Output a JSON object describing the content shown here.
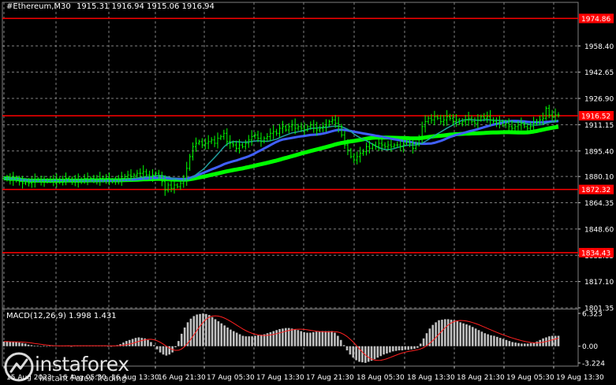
{
  "header": {
    "symbol": "#Ethereum,M30",
    "ohlc": "1915.31 1916.94 1915.06 1916.94"
  },
  "macd": {
    "label": "MACD(12,26,9) 1.998 1.431",
    "axis_labels": [
      "6.323",
      "0.00",
      "-3.224"
    ]
  },
  "branding": {
    "name": "instaforex",
    "tagline": "Instant Forex Trading"
  },
  "colors": {
    "background": "#000000",
    "candle": "#00ff00",
    "grid": "#808080",
    "level_line": "#ff0000",
    "ma_fast": "#20a0a0",
    "ma_medium": "#4060ff",
    "ma_slow": "#00ff00",
    "macd_hist": "#c0c0c0",
    "macd_signal": "#ff2020"
  },
  "chart_data": {
    "type": "candlestick",
    "symbol": "#Ethereum",
    "timeframe": "M30",
    "ylim": [
      1801.35,
      1984.5
    ],
    "price_ticks": [
      "1958.40",
      "1942.65",
      "1926.90",
      "1911.15",
      "1895.40",
      "1880.10",
      "1864.35",
      "1848.60",
      "1832.85",
      "1817.10",
      "1801.35"
    ],
    "x_ticks": [
      "15 Aug 2023",
      "16 Aug 05:30",
      "16 Aug 13:30",
      "16 Aug 21:30",
      "17 Aug 05:30",
      "17 Aug 13:30",
      "17 Aug 21:30",
      "18 Aug 05:30",
      "18 Aug 13:30",
      "18 Aug 21:30",
      "19 Aug 05:30",
      "19 Aug 13:30"
    ],
    "levels": [
      {
        "label": "1974.86",
        "value": 1974.86
      },
      {
        "label": "1916.52",
        "value": 1916.52
      },
      {
        "label": "1872.32",
        "value": 1872.32
      },
      {
        "label": "1834.43",
        "value": 1834.43
      }
    ],
    "close_series": [
      1879,
      1879,
      1878,
      1879,
      1878,
      1877,
      1876,
      1877,
      1876,
      1877,
      1878,
      1878,
      1877,
      1877,
      1878,
      1878,
      1877,
      1878,
      1877,
      1878,
      1879,
      1878,
      1877,
      1878,
      1877,
      1878,
      1879,
      1878,
      1879,
      1878,
      1878,
      1879,
      1878,
      1879,
      1878,
      1877,
      1878,
      1878,
      1879,
      1880,
      1881,
      1880,
      1881,
      1882,
      1882,
      1883,
      1881,
      1880,
      1881,
      1882,
      1880,
      1877,
      1872,
      1875,
      1873,
      1875,
      1874,
      1876,
      1878,
      1885,
      1892,
      1898,
      1900,
      1901,
      1899,
      1900,
      1901,
      1902,
      1900,
      1903,
      1904,
      1906,
      1901,
      1900,
      1899,
      1897,
      1899,
      1898,
      1900,
      1902,
      1904,
      1905,
      1903,
      1901,
      1903,
      1904,
      1906,
      1907,
      1906,
      1909,
      1910,
      1908,
      1910,
      1911,
      1909,
      1910,
      1909,
      1908,
      1910,
      1911,
      1909,
      1908,
      1909,
      1910,
      1911,
      1913,
      1914,
      1912,
      1910,
      1905,
      1899,
      1896,
      1892,
      1890,
      1892,
      1894,
      1895,
      1898,
      1897,
      1899,
      1898,
      1900,
      1899,
      1898,
      1899,
      1898,
      1899,
      1899,
      1898,
      1900,
      1901,
      1900,
      1897,
      1900,
      1903,
      1910,
      1913,
      1915,
      1914,
      1916,
      1915,
      1913,
      1914,
      1916,
      1915,
      1913,
      1914,
      1912,
      1913,
      1914,
      1915,
      1913,
      1912,
      1914,
      1916,
      1915,
      1916,
      1914,
      1913,
      1912,
      1913,
      1911,
      1912,
      1910,
      1909,
      1910,
      1911,
      1912,
      1910,
      1909,
      1910,
      1912,
      1913,
      1914,
      1915,
      1921,
      1917,
      1916,
      1917,
      1916.94
    ],
    "macd_hist_series": [
      0.9,
      0.9,
      0.8,
      0.8,
      0.8,
      0.7,
      0.6,
      0.5,
      0.3,
      0.2,
      0.1,
      0.1,
      0.0,
      0.1,
      0.0,
      0.1,
      0.1,
      0.1,
      0.1,
      0.1,
      0.1,
      0.1,
      0.0,
      0.1,
      0.1,
      0.1,
      0.1,
      0.1,
      0.1,
      0.1,
      0.1,
      0.1,
      0.1,
      0.1,
      0.0,
      0.0,
      0.1,
      0.2,
      0.4,
      0.7,
      1.0,
      1.2,
      1.4,
      1.6,
      1.7,
      1.6,
      1.5,
      1.2,
      0.8,
      0.2,
      -0.6,
      -1.2,
      -1.6,
      -1.8,
      -1.6,
      -1.2,
      -0.2,
      1.0,
      2.4,
      3.6,
      4.6,
      5.3,
      5.8,
      6.1,
      6.2,
      6.3,
      6.2,
      6.0,
      5.6,
      5.2,
      4.8,
      4.4,
      4.0,
      3.6,
      3.2,
      2.9,
      2.6,
      2.3,
      2.0,
      1.9,
      1.9,
      1.9,
      2.0,
      2.1,
      2.2,
      2.3,
      2.5,
      2.7,
      2.9,
      3.1,
      3.3,
      3.4,
      3.5,
      3.5,
      3.4,
      3.3,
      3.1,
      2.9,
      2.7,
      2.6,
      2.6,
      2.7,
      2.8,
      2.8,
      2.9,
      2.9,
      2.9,
      2.9,
      2.6,
      2.0,
      1.2,
      0.2,
      -0.8,
      -1.6,
      -2.2,
      -2.7,
      -3.0,
      -3.1,
      -3.2,
      -3.0,
      -2.8,
      -2.5,
      -2.2,
      -1.9,
      -1.6,
      -1.4,
      -1.2,
      -1.0,
      -0.9,
      -0.8,
      -0.8,
      -0.7,
      -0.7,
      -0.6,
      -0.5,
      -0.3,
      0.5,
      1.5,
      2.5,
      3.4,
      4.1,
      4.6,
      5.0,
      5.1,
      5.2,
      5.2,
      5.1,
      5.0,
      4.8,
      4.6,
      4.4,
      4.2,
      4.0,
      3.7,
      3.4,
      3.1,
      2.8,
      2.5,
      2.3,
      2.1,
      2.0,
      1.8,
      1.6,
      1.4,
      1.2,
      1.0,
      0.8,
      0.7,
      0.6,
      0.5,
      0.5,
      0.5,
      0.6,
      0.7,
      0.9,
      1.2,
      1.5,
      1.7,
      1.9,
      2.0,
      2.0,
      2.0
    ],
    "macd_ylim": [
      -3.224,
      6.323
    ]
  }
}
